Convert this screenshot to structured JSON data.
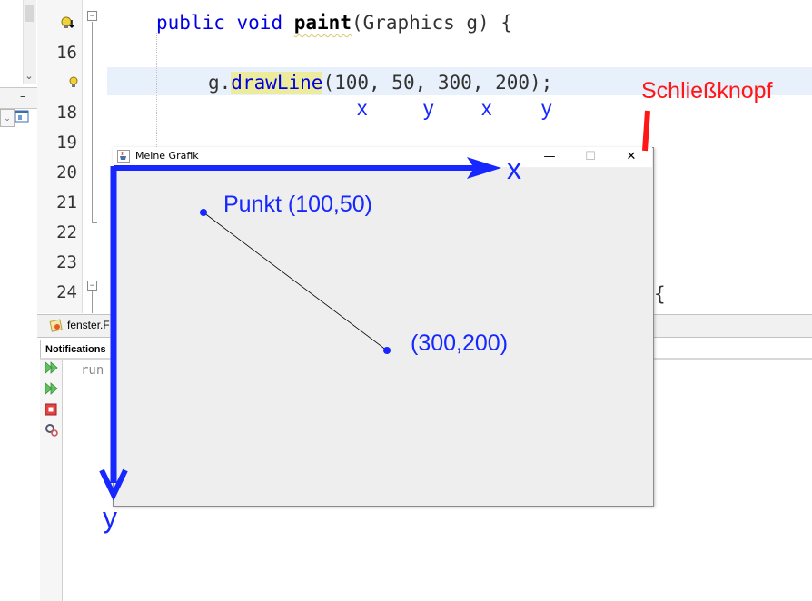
{
  "editor": {
    "line_numbers": [
      "16",
      "18",
      "19",
      "20",
      "21",
      "22",
      "23",
      "24"
    ],
    "line_paint": {
      "keyword1": "public",
      "keyword2": "void",
      "method": "paint",
      "rest": "(Graphics g) {"
    },
    "line_drawline": {
      "object": "g.",
      "method": "drawLine",
      "args": "(100, 50, 300, 200);"
    },
    "line_24_tail": "{"
  },
  "bottom": {
    "file_tab": "fenster.F",
    "notifications_label": "Notifications",
    "output_text": "run"
  },
  "window": {
    "title": "Meine Grafik",
    "minimize_glyph": "—",
    "maximize_glyph": "☐",
    "close_glyph": "✕"
  },
  "annotations": {
    "arg_labels": [
      "x",
      "y",
      "x",
      "y"
    ],
    "close_button_label": "Schließknopf",
    "axis_x": "x",
    "axis_y": "y",
    "point_start": "Punkt (100,50)",
    "point_end": "(300,200)"
  },
  "colors": {
    "annotation_blue": "#1727ff",
    "annotation_red": "#ff1717",
    "keyword_blue": "#0000e6",
    "current_line": "#e8f0fb"
  }
}
